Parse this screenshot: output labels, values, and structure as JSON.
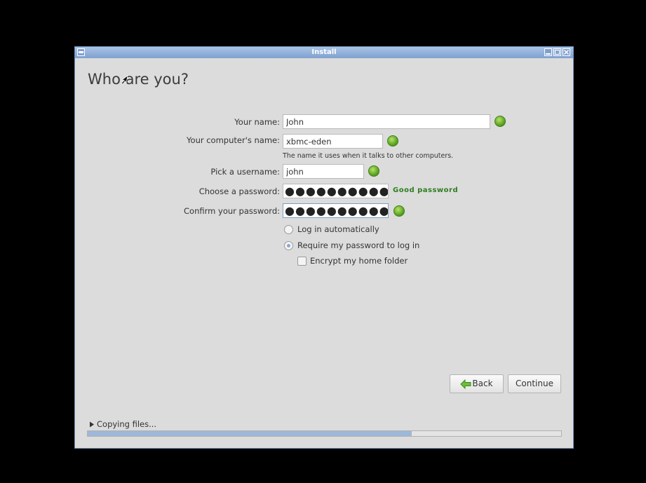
{
  "window": {
    "title": "Install",
    "heading": "Who are you?"
  },
  "form": {
    "name_label": "Your name:",
    "name_value": "John",
    "computer_label": "Your computer's name:",
    "computer_value": "xbmc-eden",
    "computer_hint": "The name it uses when it talks to other computers.",
    "username_label": "Pick a username:",
    "username_value": "john",
    "password_label": "Choose a password:",
    "password_value": "●●●●●●●●●●●●●●●",
    "password_strength": "Good password",
    "confirm_label": "Confirm your password:",
    "confirm_value": "●●●●●●●●●●●●●●●"
  },
  "options": {
    "auto_login": "Log in automatically",
    "require_password": "Require my password to log in",
    "encrypt_home": "Encrypt my home folder",
    "selected": "require_password",
    "encrypt_checked": false
  },
  "buttons": {
    "back": "Back",
    "continue": "Continue"
  },
  "status": {
    "expander_label": "Copying files...",
    "progress": 0.685
  },
  "icons": {
    "valid": "check-ok-icon",
    "back_arrow": "green-left-arrow-icon"
  },
  "colors": {
    "accent_green": "#5da523",
    "strength_text": "#2e7d1f",
    "titlebar": "#8fb0da",
    "progress_fill": "#9db8d8"
  }
}
